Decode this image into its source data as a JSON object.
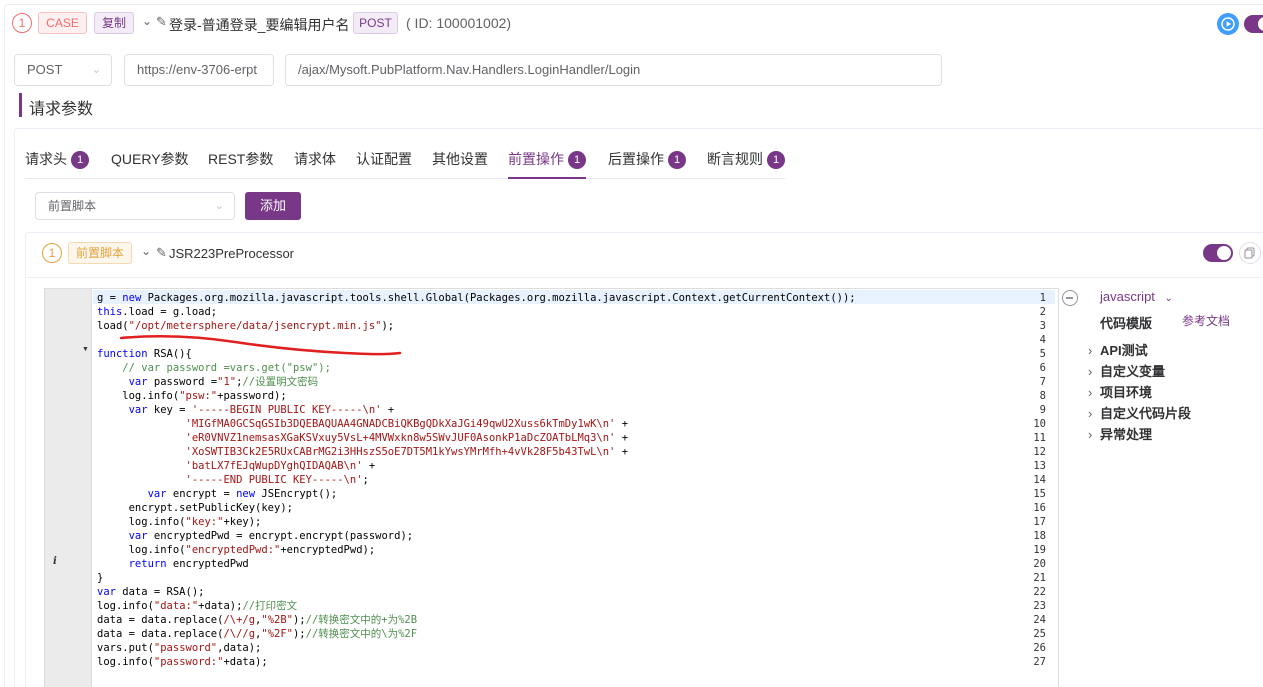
{
  "header": {
    "step_number": "1",
    "case_tag": "CASE",
    "copy_tag": "复制",
    "title": "登录-普通登录_要编辑用户名",
    "method_tag": "POST",
    "id_text": "( ID: 100001002)"
  },
  "request": {
    "method": "POST",
    "base_url": "https://env-3706-erpt",
    "path": "/ajax/Mysoft.PubPlatform.Nav.Handlers.LoginHandler/Login"
  },
  "section_title": "请求参数",
  "tabs": [
    {
      "label": "请求头",
      "badge": "1"
    },
    {
      "label": "QUERY参数",
      "badge": ""
    },
    {
      "label": "REST参数",
      "badge": ""
    },
    {
      "label": "请求体",
      "badge": ""
    },
    {
      "label": "认证配置",
      "badge": ""
    },
    {
      "label": "其他设置",
      "badge": ""
    },
    {
      "label": "前置操作",
      "badge": "1"
    },
    {
      "label": "后置操作",
      "badge": "1"
    },
    {
      "label": "断言规则",
      "badge": "1"
    }
  ],
  "pre_select": {
    "value": "前置脚本"
  },
  "add_button": "添加",
  "processor": {
    "step_number": "1",
    "tag": "前置脚本",
    "title": "JSR223PreProcessor"
  },
  "script_panel": {
    "language": "javascript",
    "template_label": "代码模版",
    "docs_link": "参考文档",
    "tree": [
      "API测试",
      "自定义变量",
      "项目环境",
      "自定义代码片段",
      "异常处理"
    ]
  },
  "colors": {
    "accent": "#783887",
    "danger": "#f56c6c",
    "warning": "#e6a23c",
    "annotation": "#e02020"
  },
  "code_lines": [
    {
      "n": "1",
      "html": "g = <span class='kw'>new</span> Packages.org.mozilla.javascript.tools.shell.Global(Packages.org.mozilla.javascript.Context.getCurrentContext());"
    },
    {
      "n": "2",
      "html": "<span class='kw'>this</span>.load = g.load;"
    },
    {
      "n": "3",
      "html": "load(<span class='str'>\"/opt/metersphere/data/jsencrypt.min.js\"</span>);"
    },
    {
      "n": "4",
      "html": ""
    },
    {
      "n": "5",
      "html": "<span class='kw'>function</span> RSA(){"
    },
    {
      "n": "6",
      "html": "    <span class='cm'>// var password =vars.get(\"psw\");</span>"
    },
    {
      "n": "7",
      "html": "     <span class='kw'>var</span> password =<span class='str'>\"1\"</span>;<span class='cm'>//设置明文密码</span>"
    },
    {
      "n": "8",
      "html": "    log.info(<span class='str'>\"psw:\"</span>+password);"
    },
    {
      "n": "9",
      "html": "     <span class='kw'>var</span> key = <span class='str'>'-----BEGIN PUBLIC KEY-----\\n'</span> +"
    },
    {
      "n": "10",
      "html": "              <span class='str'>'MIGfMA0GCSqGSIb3DQEBAQUAA4GNADCBiQKBgQDkXaJGi49qwU2Xuss6kTmDy1wK\\n'</span> +"
    },
    {
      "n": "11",
      "html": "              <span class='str'>'eR0VNVZ1nemsasXGaKSVxuy5VsL+4MVWxkn8w5SWvJUF0AsonkP1aDcZOATbLMq3\\n'</span> +"
    },
    {
      "n": "12",
      "html": "              <span class='str'>'XoSWTIB3Ck2E5RUxCABrMG2i3HHszS5oE7DT5M1kYwsYMrMfh+4vVk28F5b43TwL\\n'</span> +"
    },
    {
      "n": "13",
      "html": "              <span class='str'>'batLX7fEJqWupDYghQIDAQAB\\n'</span> +"
    },
    {
      "n": "14",
      "html": "              <span class='str'>'-----END PUBLIC KEY-----\\n'</span>;"
    },
    {
      "n": "15",
      "html": "        <span class='kw'>var</span> encrypt = <span class='kw'>new</span> JSEncrypt();"
    },
    {
      "n": "16",
      "html": "     encrypt.setPublicKey(key);"
    },
    {
      "n": "17",
      "html": "     log.info(<span class='str'>\"key:\"</span>+key);"
    },
    {
      "n": "18",
      "html": "     <span class='kw'>var</span> encryptedPwd = encrypt.encrypt(password);"
    },
    {
      "n": "19",
      "html": "     log.info(<span class='str'>\"encryptedPwd:\"</span>+encryptedPwd);"
    },
    {
      "n": "20",
      "html": "     <span class='kw'>return</span> encryptedPwd"
    },
    {
      "n": "21",
      "html": "}"
    },
    {
      "n": "22",
      "html": "<span class='kw'>var</span> data = RSA();"
    },
    {
      "n": "23",
      "html": "log.info(<span class='str'>\"data:\"</span>+data);<span class='cm'>//打印密文</span>"
    },
    {
      "n": "24",
      "html": "data = data.replace(<span class='str'>/\\+/g</span>,<span class='str'>\"%2B\"</span>);<span class='cm'>//转换密文中的+为%2B</span>"
    },
    {
      "n": "25",
      "html": "data = data.replace(<span class='str'>/\\//g</span>,<span class='str'>\"%2F\"</span>);<span class='cm'>//转换密文中的\\为%2F</span>"
    },
    {
      "n": "26",
      "html": "vars.put(<span class='str'>\"password\"</span>,data);"
    },
    {
      "n": "27",
      "html": "log.info(<span class='str'>\"password:\"</span>+data);"
    }
  ]
}
